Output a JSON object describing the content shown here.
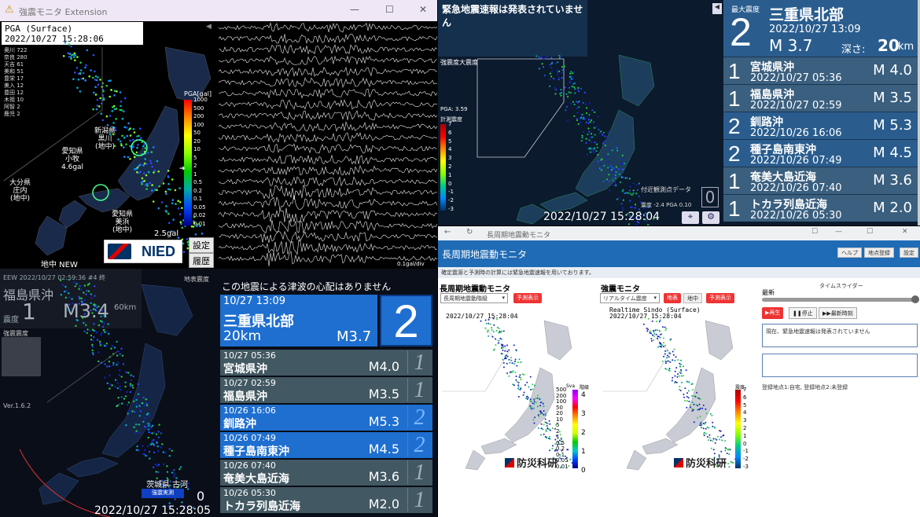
{
  "top_left": {
    "window_title": "強震モニタ Extension",
    "pga_title": "PGA (Surface)",
    "pga_time": "2022/10/27 15:28:06",
    "station_list": [
      "奥川 722",
      "奈良 280",
      "天吉 61",
      "美和 51",
      "豊栄 17",
      "美入 12",
      "豊田 12",
      "木祖 10",
      "阿智 2",
      "鹿児 2"
    ],
    "scale_title": "PGA[gal]",
    "scale_ticks": [
      "1000",
      "500",
      "200",
      "100",
      "50",
      "20",
      "10",
      "5",
      "2",
      "1",
      "0.5",
      "0.2",
      "0.1",
      "0.05",
      "0.02",
      "0.01"
    ],
    "annotations": [
      {
        "name": "niigata",
        "text": "新潟県\n黒川\n(地中)"
      },
      {
        "name": "aichi",
        "text": "愛知県\n小牧\n4.6gal"
      },
      {
        "name": "oita",
        "text": "大分県\n庄内\n(地中)"
      },
      {
        "name": "aichi2",
        "text": "愛知県\n美浜\n(地中)"
      }
    ],
    "max_gal": "2.5gal",
    "mode_label": "地中 NEW",
    "logo_text": "NIED",
    "buttons": {
      "settings": "設定",
      "history": "履歴"
    },
    "wave_footer": "0.1gal/div"
  },
  "top_right": {
    "banner": "緊急地震速報は発表されていません",
    "legend_title": "強震度大震度",
    "pga_value": "PGA: 3.59",
    "keisoku": "計測震度",
    "scale_ticks": [
      "7",
      "6",
      "5",
      "4",
      "3",
      "2",
      "1",
      "0",
      "-1",
      "-2",
      "-3"
    ],
    "nearby_label": "付近観測点データ",
    "nearby_detail": "震度 -2.4  PGA 0.10",
    "nearby_count": "0",
    "timestamp": "2022/10/27 15:28:04",
    "latest": {
      "label": "最大震度",
      "intensity": "2",
      "place": "三重県北部",
      "time": "2022/10/27  13:09",
      "magnitude": "M 3.7",
      "depth_label": "深さ:",
      "depth_value": "20",
      "depth_unit": "km"
    },
    "history": [
      {
        "intensity": "1",
        "place": "宮城県沖",
        "time": "2022/10/27  05:36",
        "mag": "M 4.0",
        "bg": "#3a5f7f"
      },
      {
        "intensity": "1",
        "place": "福島県沖",
        "time": "2022/10/27  02:59",
        "mag": "M 3.5",
        "bg": "#3a5f7f"
      },
      {
        "intensity": "2",
        "place": "釧路沖",
        "time": "2022/10/26  16:06",
        "mag": "M 5.3",
        "bg": "#2a5d8e"
      },
      {
        "intensity": "2",
        "place": "種子島南東沖",
        "time": "2022/10/26  07:49",
        "mag": "M 4.5",
        "bg": "#2a5d8e"
      },
      {
        "intensity": "1",
        "place": "奄美大島近海",
        "time": "2022/10/26  07:40",
        "mag": "M 3.6",
        "bg": "#3a5f7f"
      },
      {
        "intensity": "1",
        "place": "トカラ列島近海",
        "time": "2022/10/26  05:30",
        "mag": "M 2.0",
        "bg": "#3a5f7f"
      }
    ]
  },
  "bottom_left": {
    "eew_header": "EEW  2022/10/27 02:59:36 #4 終",
    "eew_place": "福島県沖",
    "eew_shindo_label": "震度",
    "eew_shindo": "1",
    "eew_mag": "M3.4",
    "eew_depth": "60km",
    "map_label": "地表震度",
    "left_label": "強震震度",
    "version": "Ver.1.6.2",
    "station": "茨城県 古河",
    "station_sub": "強震実測",
    "station_value": "0",
    "timestamp": "2022/10/27  15:28:05",
    "tsunami": "この地震による津波の心配はありません",
    "latest": {
      "date": "10/27  13:09",
      "place": "三重県北部",
      "depth": "20km",
      "mag": "M3.7",
      "intensity": "2"
    },
    "history": [
      {
        "date": "10/27  05:36",
        "place": "宮城県沖",
        "mag": "M4.0",
        "intensity": "1",
        "hi": false
      },
      {
        "date": "10/27  02:59",
        "place": "福島県沖",
        "mag": "M3.5",
        "intensity": "1",
        "hi": false
      },
      {
        "date": "10/26  16:06",
        "place": "釧路沖",
        "mag": "M5.3",
        "intensity": "2",
        "hi": true
      },
      {
        "date": "10/26  07:49",
        "place": "種子島南東沖",
        "mag": "M4.5",
        "intensity": "2",
        "hi": true
      },
      {
        "date": "10/26  07:40",
        "place": "奄美大島近海",
        "mag": "M3.6",
        "intensity": "1",
        "hi": false
      },
      {
        "date": "10/26  05:30",
        "place": "トカラ列島近海",
        "mag": "M2.0",
        "intensity": "1",
        "hi": false
      }
    ]
  },
  "bottom_right": {
    "browser_title": "長周期地震動モニタ",
    "app_title": "長周期地震動モニタ",
    "header_buttons": [
      "ヘルプ",
      "地点登録",
      "設定"
    ],
    "note": "確定震源と予測時の計算には緊急地震速報を用いております。",
    "left_panel": {
      "title": "長周期地震動モニタ",
      "select": "長周期地震動階級",
      "button": "予測表示",
      "timestamp": "2022/10/27  15:28:04",
      "legend_title": "Sva",
      "legend_right": "階級",
      "ticks": [
        "500",
        "200",
        "100",
        "50",
        "20",
        "10",
        "5",
        "2",
        "1",
        "0.5",
        "0.2",
        "0.1",
        "0.05",
        "0.01"
      ],
      "class_ticks": [
        "4",
        "3",
        "2",
        "1",
        "0"
      ]
    },
    "right_panel": {
      "title": "強震モニタ",
      "select": "リアルタイム震度",
      "btn_surface": "地表",
      "btn_under": "地中",
      "button": "予測表示",
      "ts_title": "Realtime Sindo (Surface)",
      "timestamp": "2022/10/27  15:28:04",
      "legend_title": "震度",
      "ticks": [
        "7",
        "6",
        "5",
        "4",
        "3",
        "2",
        "1",
        "0",
        "-1",
        "-2",
        "-3"
      ]
    },
    "logo_text": "防災科研",
    "logo_sub": "NIED",
    "timeslider": {
      "label": "タイムスライダー",
      "latest": "最新",
      "play": "▶再生",
      "stop": "❚❚停止",
      "latest_time": "▶▶最新時刻"
    },
    "status_text": "現在、緊急地震速報は発表されていません",
    "footer": "登録地点1:自宅, 登録地点2:未登録"
  }
}
